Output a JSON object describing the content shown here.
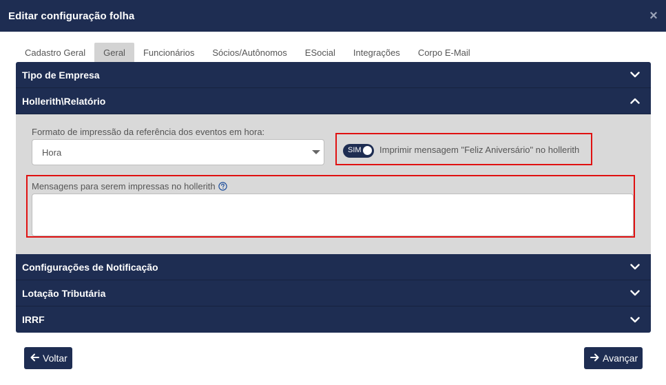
{
  "modal": {
    "title": "Editar configuração folha",
    "close_symbol": "×"
  },
  "tabs": [
    {
      "label": "Cadastro Geral",
      "active": false
    },
    {
      "label": "Geral",
      "active": true
    },
    {
      "label": "Funcionários",
      "active": false
    },
    {
      "label": "Sócios/Autônomos",
      "active": false
    },
    {
      "label": "ESocial",
      "active": false
    },
    {
      "label": "Integrações",
      "active": false
    },
    {
      "label": "Corpo E-Mail",
      "active": false
    }
  ],
  "accordion": {
    "sections": [
      {
        "title": "Tipo de Empresa",
        "expanded": false,
        "icon": "chevron-down-icon"
      },
      {
        "title": "Hollerith\\Relatório",
        "expanded": true,
        "icon": "chevron-up-icon"
      },
      {
        "title": "Configurações de Notificação",
        "expanded": false,
        "icon": "chevron-down-icon"
      },
      {
        "title": "Lotação Tributária",
        "expanded": false,
        "icon": "chevron-down-icon"
      },
      {
        "title": "IRRF",
        "expanded": false,
        "icon": "chevron-down-icon"
      }
    ]
  },
  "hollerith": {
    "format_label": "Formato de impressão da referência dos eventos em hora:",
    "format_value": "Hora",
    "toggle_text": "SIM",
    "toggle_on": true,
    "toggle_label": "Imprimir mensagem \"Feliz Aniversário\" no hollerith",
    "messages_label": "Mensagens para serem impressas no hollerith",
    "messages_value": ""
  },
  "footer": {
    "back_label": "Voltar",
    "next_label": "Avançar"
  },
  "colors": {
    "navy": "#1e2d52",
    "panel": "#d9d9d9",
    "highlight": "#e01010"
  }
}
